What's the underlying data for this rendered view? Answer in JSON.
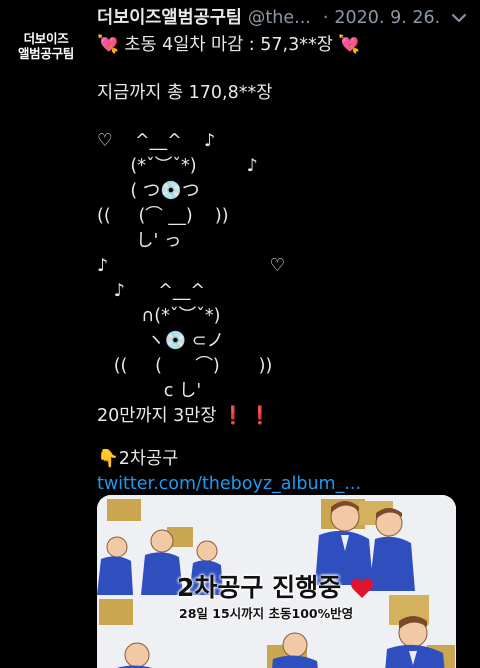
{
  "author": {
    "avatar_line1": "더보이즈",
    "avatar_line2": "앨범공구팀",
    "display_name": "더보이즈앨범공구팀",
    "handle": "@the...",
    "separator": "·",
    "date": "2020. 9. 26."
  },
  "tweet": {
    "line_1": "💘 초동 4일차 마감 : 57,3**장 💘",
    "line_2": "지금까지 총 170,8**장",
    "art_1": "♡    ^__^    ♪",
    "art_2": "      (*ˇ︶ˇ*)         ♪",
    "art_3": "      ( つ💿つ",
    "art_4": "((     (⌒ __)    ))",
    "art_5": "       し' っ",
    "art_6": "♪                             ♡",
    "art_7": "   ♪      ^__^",
    "art_8": "        ∩(*ˇ︶ˇ*)",
    "art_9": "         ヽ💿 ⊂ノ",
    "art_10": "   ((     (      ⌒)       ))",
    "art_11": "            c し'",
    "line_3": "20만까지 3만장 ❗ ❗",
    "line_4": "👇2차공구",
    "link": "twitter.com/theboyz_album_..."
  },
  "card": {
    "title": "2차공구 진행중",
    "subtitle": "28일 15시까지 초동100%반영"
  },
  "icons": {
    "caret": "chevron-down-icon",
    "heart": "heart-icon"
  },
  "colors": {
    "background": "#000000",
    "text": "#e7e9ea",
    "secondary": "#8b98a5",
    "link": "#1d9bf0",
    "heart": "#e0142e"
  }
}
